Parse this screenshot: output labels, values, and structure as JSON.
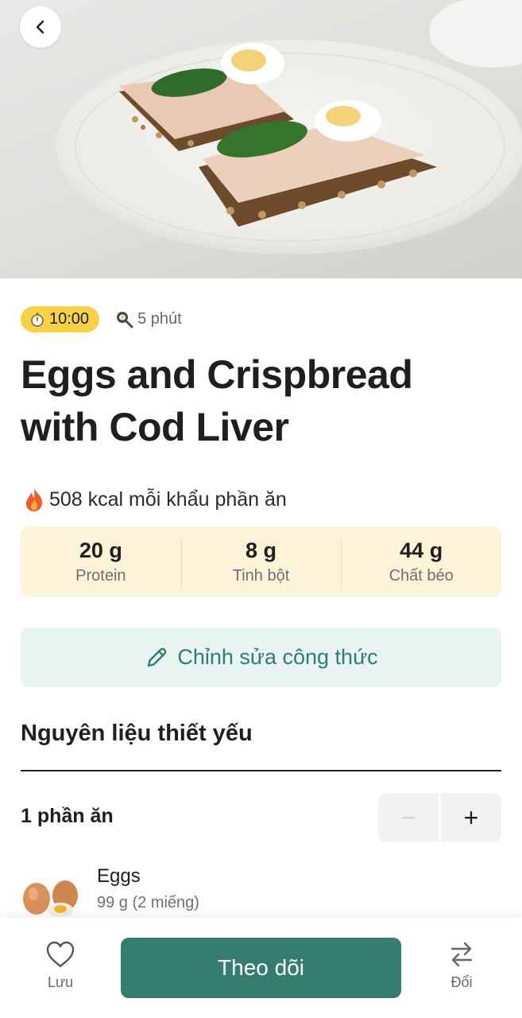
{
  "header": {
    "back_icon": "chevron-left-icon",
    "hero_image": "eggs-crispbread-cod-liver-photo"
  },
  "meta": {
    "timer": "10:00",
    "timer_icon": "stopwatch-icon",
    "cook_time": "5 phút",
    "cook_icon": "frying-pan-icon"
  },
  "recipe": {
    "title": "Eggs and Crispbread with Cod Liver",
    "kcal_text": "508 kcal mỗi khẩu phần ăn",
    "kcal_icon": "fire-icon"
  },
  "macros": [
    {
      "value": "20 g",
      "label": "Protein"
    },
    {
      "value": "8 g",
      "label": "Tinh bột"
    },
    {
      "value": "44 g",
      "label": "Chất béo"
    }
  ],
  "edit": {
    "label": "Chỉnh sửa công thức",
    "icon": "pencil-icon"
  },
  "ingredients_section": {
    "title": "Nguyên liệu thiết yếu",
    "servings": "1 phần ăn",
    "minus": "−",
    "plus": "+",
    "items": [
      {
        "name": "Eggs",
        "qty": "99 g (2 miếng)"
      }
    ]
  },
  "bottom_bar": {
    "save_label": "Lưu",
    "follow_label": "Theo dõi",
    "swap_label": "Đổi"
  },
  "colors": {
    "primary": "#357e6f",
    "timer_badge": "#f7d247",
    "macro_bg": "#fdf3d8",
    "edit_bg": "#e8f4f2",
    "edit_text": "#2e7d70"
  }
}
